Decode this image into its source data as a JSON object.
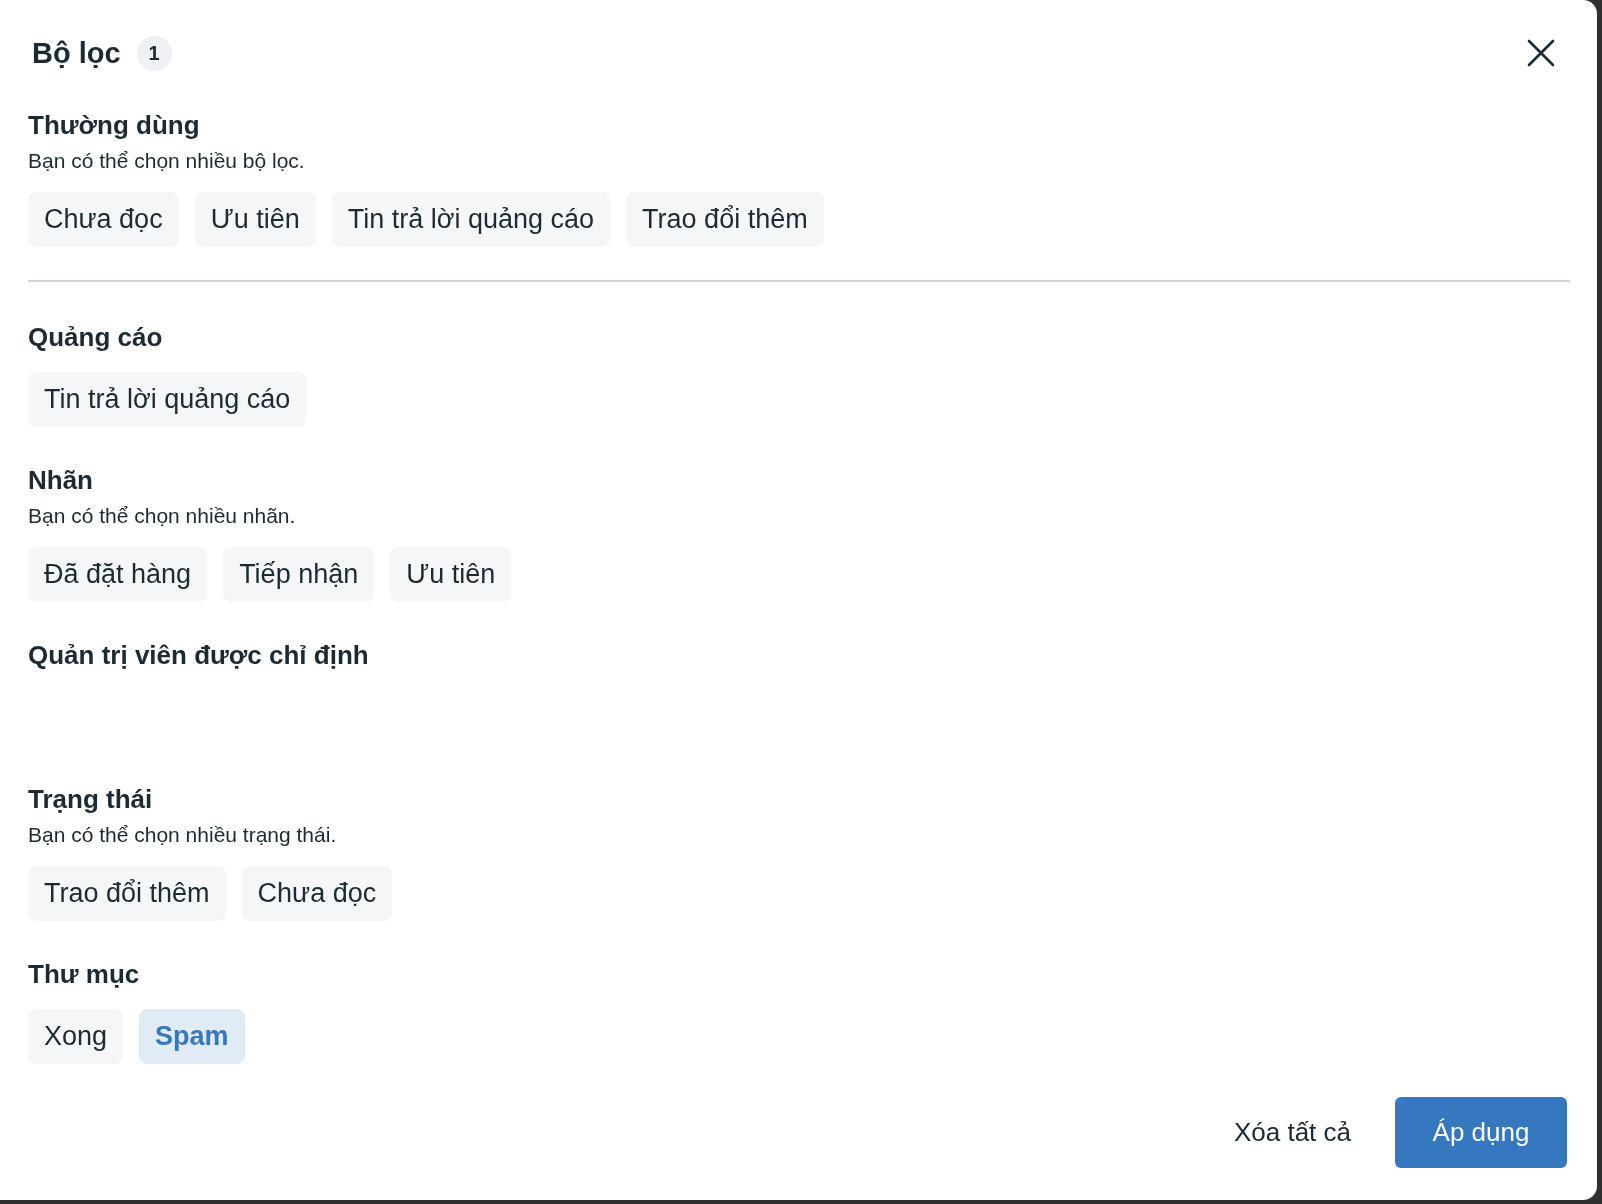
{
  "dialog": {
    "title": "Bộ lọc",
    "count_badge": "1"
  },
  "sections": [
    {
      "heading": "Thường dùng",
      "subtitle": "Bạn có thể chọn nhiều bộ lọc.",
      "divider_after": true,
      "chips": [
        {
          "label": "Chưa đọc",
          "selected": false
        },
        {
          "label": "Ưu tiên",
          "selected": false
        },
        {
          "label": "Tin trả lời quảng cáo",
          "selected": false
        },
        {
          "label": "Trao đổi thêm",
          "selected": false
        }
      ]
    },
    {
      "heading": "Quảng cáo",
      "chips": [
        {
          "label": "Tin trả lời quảng cáo",
          "selected": false
        }
      ]
    },
    {
      "heading": "Nhãn",
      "subtitle": "Bạn có thể chọn nhiều nhãn.",
      "chips": [
        {
          "label": "Đã đặt hàng",
          "selected": false
        },
        {
          "label": "Tiếp nhận",
          "selected": false
        },
        {
          "label": "Ưu tiên",
          "selected": false
        }
      ]
    },
    {
      "heading": "Quản trị viên được chỉ định"
    },
    {
      "heading": "Trạng thái",
      "subtitle": "Bạn có thể chọn nhiều trạng thái.",
      "chips": [
        {
          "label": "Trao đổi thêm",
          "selected": false
        },
        {
          "label": "Chưa đọc",
          "selected": false
        }
      ]
    },
    {
      "heading": "Thư mục",
      "chips": [
        {
          "label": "Xong",
          "selected": false
        },
        {
          "label": "Spam",
          "selected": true
        }
      ]
    }
  ],
  "footer": {
    "clear_button": "Xóa tất cả",
    "apply_button": "Áp dụng"
  }
}
